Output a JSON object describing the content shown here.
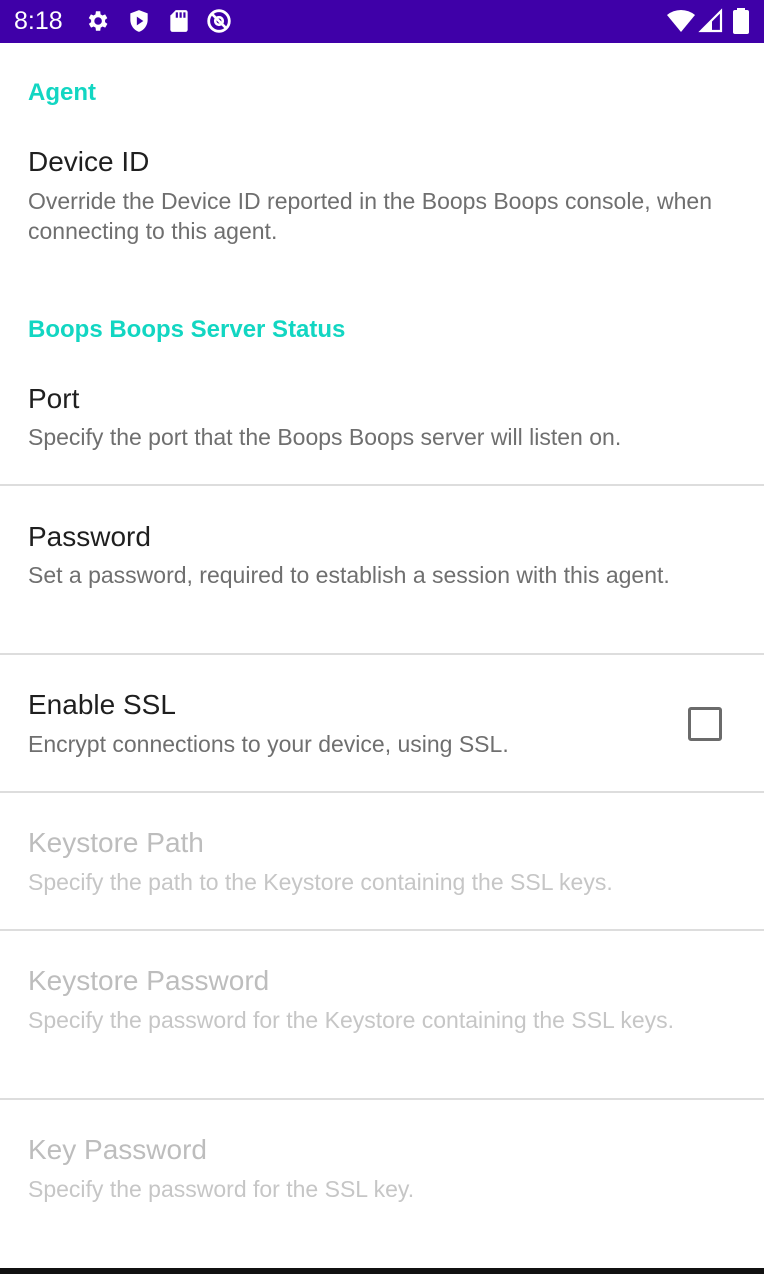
{
  "status_bar": {
    "time": "8:18",
    "left_icons": [
      "settings-icon",
      "shield-play-icon",
      "sd-card-icon",
      "blocked-at-icon"
    ],
    "right_icons": [
      "wifi-icon",
      "cell-signal-icon",
      "battery-icon"
    ],
    "background": "#3f00a8"
  },
  "accent_color": "#12d6c2",
  "sections": {
    "agent": {
      "header": "Agent",
      "device_id": {
        "title": "Device ID",
        "summary": "Override the Device ID reported in the Boops Boops console, when connecting to this agent."
      }
    },
    "server": {
      "header": "Boops Boops Server Status",
      "port": {
        "title": "Port",
        "summary": "Specify the port that the Boops Boops server will listen on."
      },
      "password": {
        "title": "Password",
        "summary": "Set a password, required to establish a session with this agent."
      },
      "enable_ssl": {
        "title": "Enable SSL",
        "summary": "Encrypt connections to your device, using SSL.",
        "checked": false
      },
      "keystore_path": {
        "title": "Keystore Path",
        "summary": "Specify the path to the Keystore containing the SSL keys.",
        "enabled": false
      },
      "keystore_password": {
        "title": "Keystore Password",
        "summary": "Specify the password for the Keystore containing the SSL keys.",
        "enabled": false
      },
      "key_password": {
        "title": "Key Password",
        "summary": "Specify the password for the SSL key.",
        "enabled": false
      }
    }
  }
}
